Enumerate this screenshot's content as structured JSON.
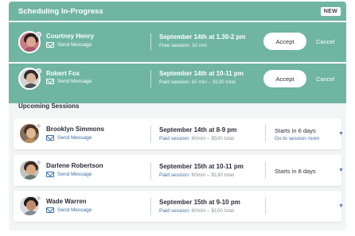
{
  "scheduling": {
    "title": "Scheduling In-Progress",
    "badge": "NEW",
    "requests": [
      {
        "name": "Courtney Henry",
        "send_label": "Send Message",
        "when": "September 14th at 1.30-2 pm",
        "detail_label": "Free session:",
        "detail_value": "30 min",
        "accept_label": "Accept",
        "cancel_label": "Cancel",
        "avatar": {
          "bg": "#c97a86",
          "hair": "#2a1d1d",
          "face": "#d9a88f",
          "body": "#a8566a"
        }
      },
      {
        "name": "Robert Fox",
        "send_label": "Send Message",
        "when": "September 14th at 10-11 pm",
        "detail_label": "Paid session:",
        "detail_value": "60 min – $130 total",
        "accept_label": "Accept",
        "cancel_label": "Cancel",
        "avatar": {
          "bg": "#cfd5d3",
          "hair": "#2e2a28",
          "face": "#d8b49c",
          "body": "#4d5155"
        }
      }
    ]
  },
  "upcoming": {
    "title": "Upcoming Sessions",
    "sessions": [
      {
        "name": "Brooklyn Simmons",
        "send_label": "Send Message",
        "when": "September 14th at 8-9 pm",
        "detail_label": "Paid session:",
        "detail_value": "60min – $500 total",
        "starts": "Starts in 6 days",
        "link": "Go to session room",
        "avatar": {
          "bg": "#8a6f59",
          "hair": "#4a3426",
          "face": "#e0b893",
          "body": "#b88c5e"
        }
      },
      {
        "name": "Darlene Robertson",
        "send_label": "Send Message",
        "when": "September 15th at 10-11 pm",
        "detail_label": "Paid session:",
        "detail_value": "60min – $130 total",
        "starts": "Starts in 8 days",
        "link": "",
        "avatar": {
          "bg": "#bfc4bf",
          "hair": "#3a2a22",
          "face": "#d8a882",
          "body": "#6b7b6e"
        }
      },
      {
        "name": "Wade Warren",
        "send_label": "Send Message",
        "when": "September 15th at 9-10 pm",
        "detail_label": "Paid session:",
        "detail_value": "60min – $100 total",
        "starts": "",
        "link": "",
        "avatar": {
          "bg": "#d6d9dd",
          "hair": "#1e1a18",
          "face": "#c08c68",
          "body": "#7e8a94"
        }
      }
    ]
  },
  "colors": {
    "accent": "#6fb5a2",
    "link": "#3b6fa6",
    "text": "#2c2c3a",
    "panel_bg": "#f3f4f6"
  }
}
